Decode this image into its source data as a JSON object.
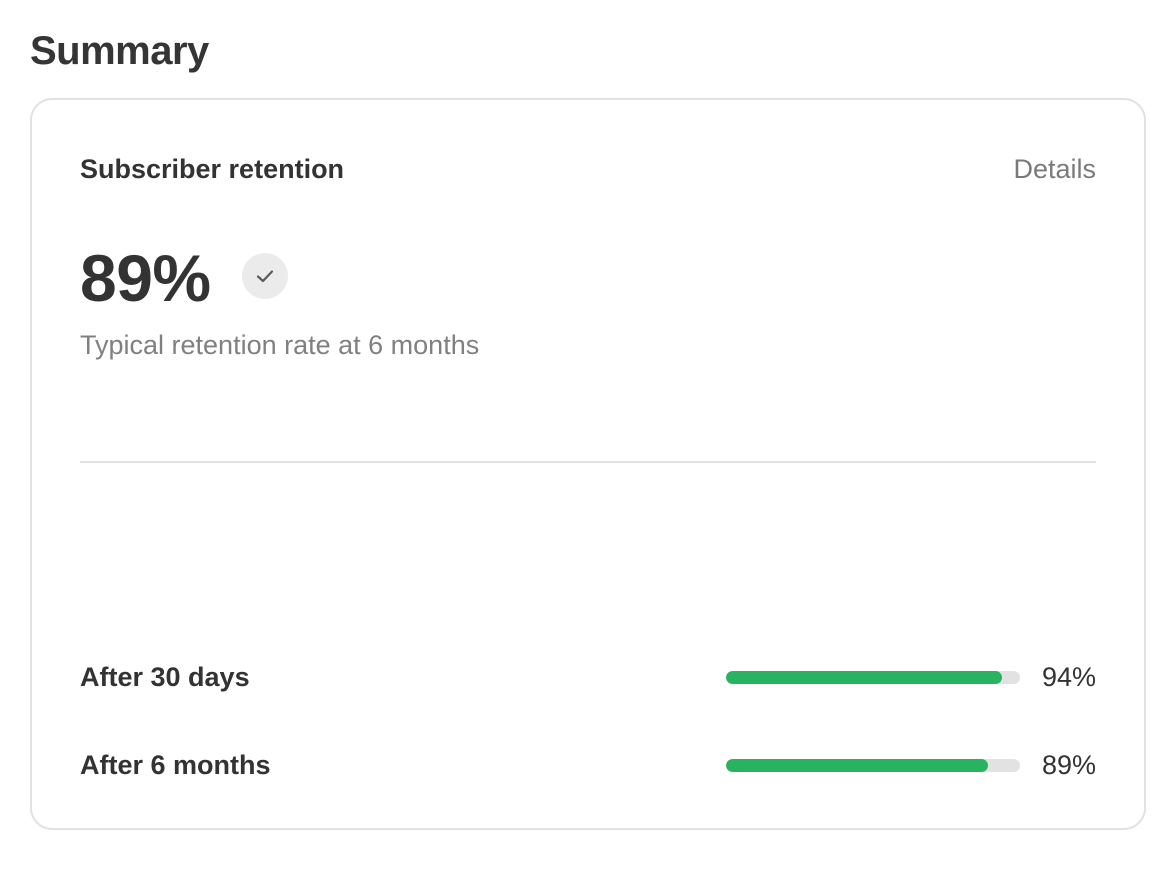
{
  "page": {
    "title": "Summary"
  },
  "card": {
    "title": "Subscriber retention",
    "details_label": "Details",
    "headline_value": "89%",
    "headline_icon": "check-icon",
    "subtitle": "Typical retention rate at 6 months",
    "metrics": [
      {
        "label": "After 30 days",
        "value": "94%",
        "fraction": 0.94
      },
      {
        "label": "After 6 months",
        "value": "89%",
        "fraction": 0.89
      }
    ]
  },
  "colors": {
    "accent_green": "#27b360",
    "track_gray": "#e2e2e2",
    "badge_gray": "#ebebeb",
    "muted_text": "#7a7a7a"
  }
}
